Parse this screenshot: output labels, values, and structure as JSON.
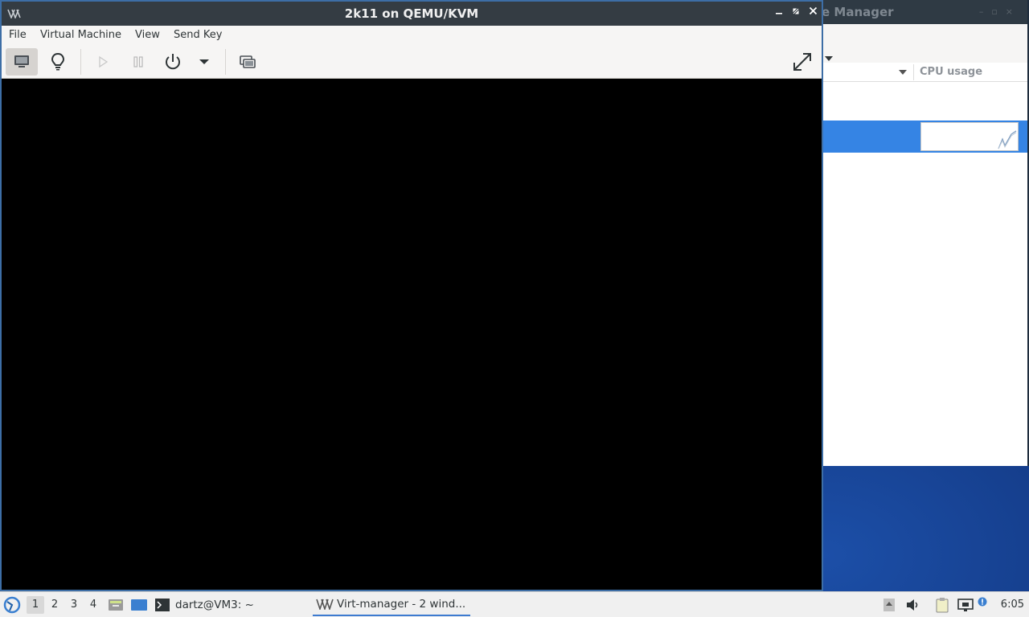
{
  "background_window": {
    "title_fragment": "e Manager",
    "column_header": "CPU usage"
  },
  "vm_window": {
    "title": "2k11 on QEMU/KVM",
    "menu": [
      "File",
      "Virtual Machine",
      "View",
      "Send Key"
    ],
    "toolbar": {
      "console_icon": "monitor-icon",
      "details_icon": "lightbulb-icon",
      "run_icon": "play-icon",
      "pause_icon": "pause-icon",
      "shutdown_icon": "power-icon",
      "snapshot_icon": "snapshots-icon",
      "fullscreen_icon": "fullscreen-icon"
    }
  },
  "taskbar": {
    "workspaces": [
      "1",
      "2",
      "3",
      "4"
    ],
    "active_workspace": "1",
    "tasks": [
      {
        "label": "dartz@VM3: ~",
        "icon": "terminal-icon"
      },
      {
        "label": "Virt-manager - 2 wind...",
        "icon": "virt-manager-icon"
      }
    ],
    "clock": "6:05"
  },
  "colors": {
    "titlebar": "#343c43",
    "selection": "#3584e4",
    "accent_border": "#3d6ea6"
  }
}
